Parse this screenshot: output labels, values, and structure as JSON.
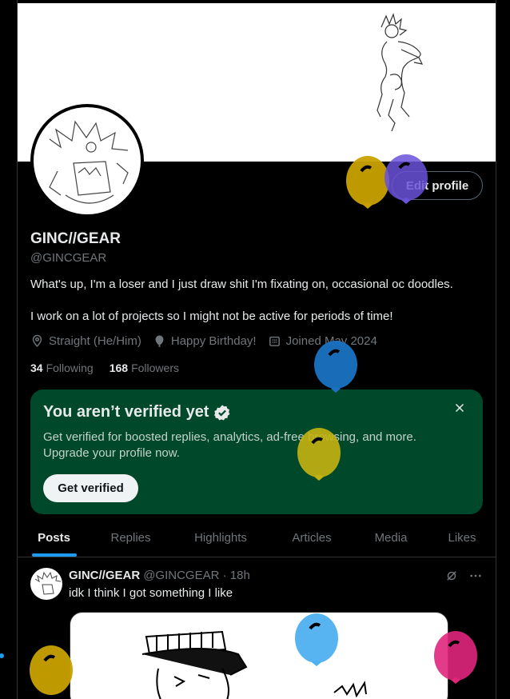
{
  "profile": {
    "name": "GINC//GEAR",
    "handle": "@GINCGEAR",
    "edit_label": "Edit profile",
    "bio_line1": "What's up, I'm a loser and I just draw shit I'm fixating on, occasional oc doodles.",
    "bio_line2": "I work on a lot of projects so I might not be active for periods of time!",
    "location": "Straight (He/Him)",
    "birthday": "Happy Birthday!",
    "joined": "Joined May 2024",
    "following_count": "34",
    "following_label": "Following",
    "followers_count": "168",
    "followers_label": "Followers"
  },
  "verify": {
    "title": "You aren’t verified yet",
    "text": "Get verified for boosted replies, analytics, ad-free browsing, and more. Upgrade your profile now.",
    "button": "Get verified"
  },
  "tabs": [
    "Posts",
    "Replies",
    "Highlights",
    "Articles",
    "Media",
    "Likes"
  ],
  "active_tab": "Posts",
  "post": {
    "name": "GINC//GEAR",
    "handle": "@GINCGEAR · 18h",
    "text": "idk I think I got something I like"
  },
  "colors": {
    "accent": "#1d9bf0",
    "verify_bg": "#00482a",
    "balloon_gold": "#c9a100",
    "balloon_purple": "#6a52d9",
    "balloon_blue": "#1a73c2",
    "balloon_yellow": "#c4b212",
    "balloon_light_blue": "#4fb0f0",
    "balloon_pink": "#e0267c"
  },
  "icons": [
    "location-icon",
    "balloon-icon",
    "calendar-icon",
    "verified-badge-icon",
    "close-icon",
    "grok-icon",
    "more-icon"
  ]
}
